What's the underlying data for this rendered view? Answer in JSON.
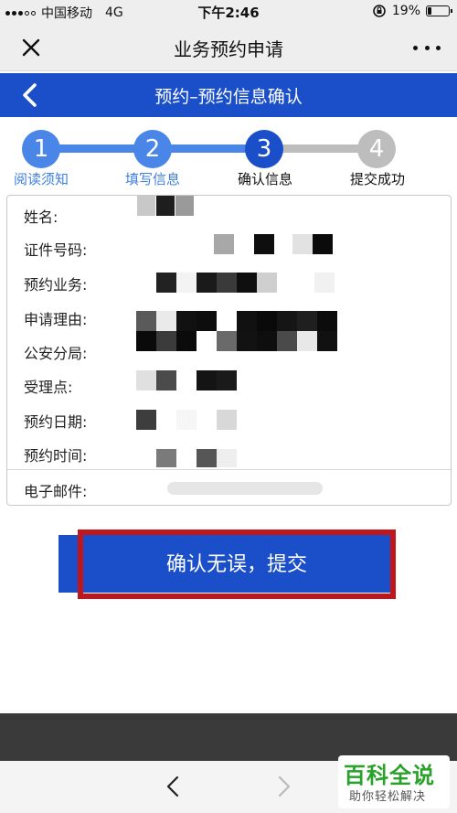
{
  "status_bar": {
    "carrier": "中国移动",
    "network": "4G",
    "time": "下午2:46",
    "battery": "19%",
    "battery_level": 0.19
  },
  "header": {
    "title": "业务预约申请"
  },
  "nav": {
    "title": "预约–预约信息确认"
  },
  "steps": [
    {
      "number": "1",
      "label": "阅读须知",
      "state": "done"
    },
    {
      "number": "2",
      "label": "填写信息",
      "state": "done"
    },
    {
      "number": "3",
      "label": "确认信息",
      "state": "current"
    },
    {
      "number": "4",
      "label": "提交成功",
      "state": "pending"
    }
  ],
  "info": {
    "name_label": "姓名:",
    "id_label": "证件号码:",
    "business_label": "预约业务:",
    "reason_label": "申请理由:",
    "bureau_label": "公安分局:",
    "office_label": "受理点:",
    "date_label": "预约日期:",
    "time_label": "预约时间:",
    "email_label": "电子邮件:"
  },
  "submit": {
    "label": "确认无误，提交"
  },
  "watermark": {
    "title": "百科全说",
    "subtitle": "助你轻松解决"
  },
  "colors": {
    "primary": "#1b4fc9",
    "step_done": "#4a86e8",
    "step_pending": "#bdbdbd",
    "highlight": "#c0171c"
  }
}
